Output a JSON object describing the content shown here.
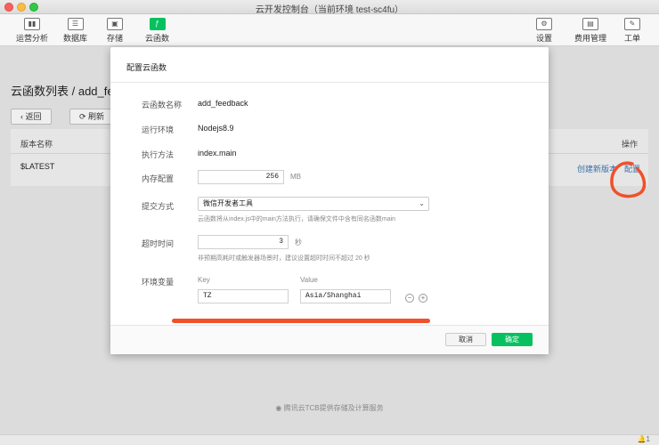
{
  "window": {
    "title": "云开发控制台（当前环境 test-sc4fu）"
  },
  "toolbar": {
    "left": [
      {
        "label": "运营分析",
        "icon": "bar-chart-icon"
      },
      {
        "label": "数据库",
        "icon": "database-icon"
      },
      {
        "label": "存储",
        "icon": "storage-icon"
      },
      {
        "label": "云函数",
        "icon": "cloud-function-icon",
        "active": true
      }
    ],
    "right": [
      {
        "label": "设置",
        "icon": "gear-icon"
      },
      {
        "label": "费用管理",
        "icon": "billing-icon"
      },
      {
        "label": "工单",
        "icon": "ticket-icon"
      }
    ]
  },
  "page": {
    "title": "云函数列表 / add_feedb",
    "back_label": "返回",
    "refresh_label": "刷新",
    "table": {
      "header_version": "版本名称",
      "header_actions": "操作",
      "row_version": "$LATEST",
      "row_action_create": "创建新版本",
      "row_action_config": "配置"
    },
    "footer": "腾讯云TCB提供存储及计算服务"
  },
  "modal": {
    "title": "配置云函数",
    "name_label": "云函数名称",
    "name_value": "add_feedback",
    "runtime_label": "运行环境",
    "runtime_value": "Nodejs8.9",
    "handler_label": "执行方法",
    "handler_value": "index.main",
    "memory_label": "内存配置",
    "memory_value": "256",
    "memory_unit": "MB",
    "submit_label": "提交方式",
    "submit_value": "微信开发者工具",
    "submit_hint": "云函数将从index.js中的main方法执行，请确保文件中含有同名函数main",
    "timeout_label": "超时时间",
    "timeout_value": "3",
    "timeout_unit": "秒",
    "timeout_hint": "非预期高耗时或触发器场景时，建议设置超时时间不超过 20 秒",
    "env_label": "环境变量",
    "env_key_header": "Key",
    "env_value_header": "Value",
    "env_key": "TZ",
    "env_value": "Asia/Shanghai",
    "cancel_label": "取消",
    "ok_label": "确定"
  },
  "colors": {
    "accent": "#07c160",
    "annotation": "#f0502a"
  }
}
